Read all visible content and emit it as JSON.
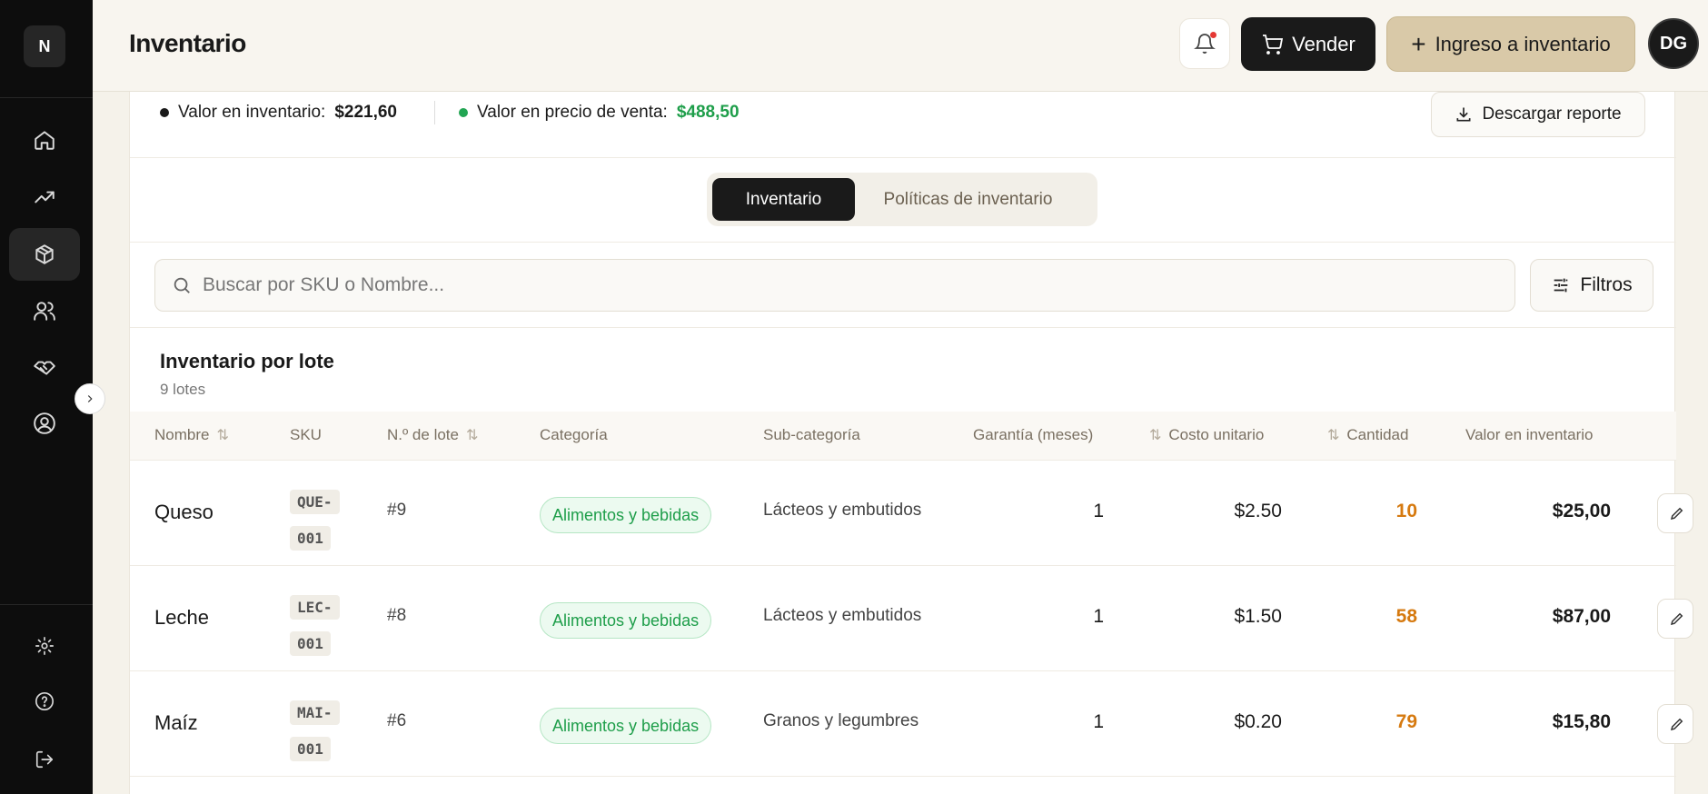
{
  "sidebar": {
    "logo": "N",
    "nav": [
      {
        "icon": "home-icon",
        "active": false
      },
      {
        "icon": "trending-up-icon",
        "active": false
      },
      {
        "icon": "package-icon",
        "active": true
      },
      {
        "icon": "users-icon",
        "active": false
      },
      {
        "icon": "handshake-icon",
        "active": false
      },
      {
        "icon": "user-circle-icon",
        "active": false
      }
    ],
    "bottom": [
      "gear-icon",
      "help-circle-icon",
      "logout-icon"
    ]
  },
  "header": {
    "title": "Inventario",
    "sell_label": "Vender",
    "ingreso_label": "Ingreso a inventario",
    "avatar_initials": "DG"
  },
  "summary": {
    "inventory_value_label": "Valor en inventario:",
    "inventory_value": "$221,60",
    "sale_value_label": "Valor en precio de venta:",
    "sale_value": "$488,50",
    "download_label": "Descargar reporte"
  },
  "tabs": {
    "active": "Inventario",
    "inactive": "Políticas de inventario"
  },
  "search": {
    "placeholder": "Buscar por SKU o Nombre...",
    "filters_label": "Filtros"
  },
  "section": {
    "title": "Inventario por lote",
    "subtitle": "9 lotes"
  },
  "table": {
    "columns": {
      "nombre": "Nombre",
      "sku": "SKU",
      "lote": "N.º de lote",
      "categoria": "Categoría",
      "subcategoria": "Sub-categoría",
      "garantia": "Garantía (meses)",
      "costo": "Costo unitario",
      "cantidad": "Cantidad",
      "valor": "Valor en inventario"
    },
    "rows": [
      {
        "nombre": "Queso",
        "sku_a": "QUE-",
        "sku_b": "001",
        "lote": "#9",
        "categoria": "Alimentos y bebidas",
        "subcategoria": "Lácteos y embutidos",
        "garantia": "1",
        "costo": "$2.50",
        "cantidad": "10",
        "valor": "$25,00"
      },
      {
        "nombre": "Leche",
        "sku_a": "LEC-",
        "sku_b": "001",
        "lote": "#8",
        "categoria": "Alimentos y bebidas",
        "subcategoria": "Lácteos y embutidos",
        "garantia": "1",
        "costo": "$1.50",
        "cantidad": "58",
        "valor": "$87,00"
      },
      {
        "nombre": "Maíz",
        "sku_a": "MAI-",
        "sku_b": "001",
        "lote": "#6",
        "categoria": "Alimentos y bebidas",
        "subcategoria": "Granos y legumbres",
        "garantia": "1",
        "costo": "$0.20",
        "cantidad": "79",
        "valor": "$15,80"
      }
    ]
  },
  "colors": {
    "dark": "#1a1a1a",
    "accent_tan": "#d9c9a8",
    "green": "#1e9e4a",
    "orange": "#d67a10"
  }
}
